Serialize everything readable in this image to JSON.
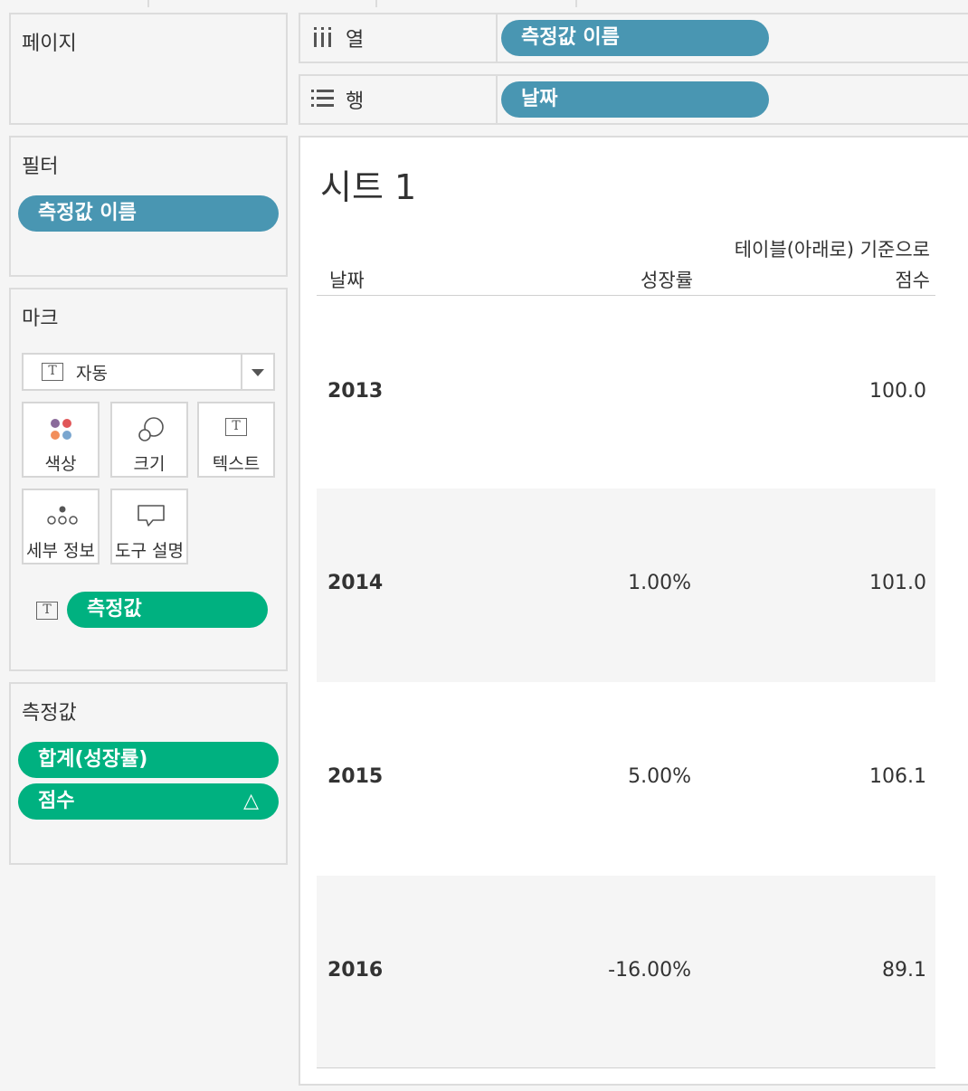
{
  "pages_card": {
    "title": "페이지"
  },
  "filters_card": {
    "title": "필터",
    "pill": "측정값 이름"
  },
  "marks_card": {
    "title": "마크",
    "mark_type": "자동",
    "buttons": [
      {
        "label": "색상",
        "icon": "color-dots-icon"
      },
      {
        "label": "크기",
        "icon": "size-circles-icon"
      },
      {
        "label": "텍스트",
        "icon": "text-box-icon"
      },
      {
        "label": "세부 정보",
        "icon": "detail-dots-icon"
      },
      {
        "label": "도구 설명",
        "icon": "speech-bubble-icon"
      }
    ],
    "text_pill": "측정값",
    "text_glyph": "T"
  },
  "measures_card": {
    "title": "측정값",
    "pills": [
      "합계(성장률)",
      "점수"
    ],
    "delta_glyph": "△"
  },
  "columns_shelf": {
    "label": "열",
    "pill": "측정값 이름"
  },
  "rows_shelf": {
    "label": "행",
    "pill": "날짜"
  },
  "sheet": {
    "title": "시트 1",
    "headers": {
      "date": "날짜",
      "growth": "성장률",
      "score_line1": "테이블(아래로) 기준으로",
      "score_line2": "점수"
    },
    "rows": [
      {
        "year": "2013",
        "growth": "",
        "score": "100.0"
      },
      {
        "year": "2014",
        "growth": "1.00%",
        "score": "101.0"
      },
      {
        "year": "2015",
        "growth": "5.00%",
        "score": "106.1"
      },
      {
        "year": "2016",
        "growth": "-16.00%",
        "score": "89.1"
      }
    ]
  },
  "colors": {
    "dimension_pill": "#4996b2",
    "measure_pill": "#00b180",
    "band": "#f5f5f5"
  }
}
